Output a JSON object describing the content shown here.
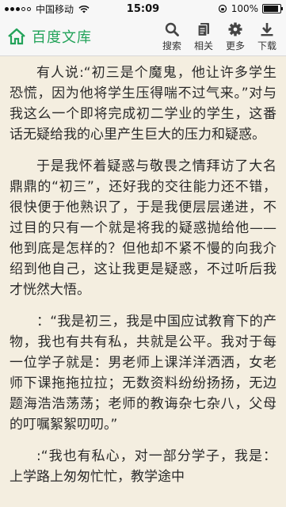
{
  "status_bar": {
    "carrier": "中国移动",
    "time": "15:09",
    "battery_text": "100%",
    "battery_level": 1.0
  },
  "app_bar": {
    "title": "百度文库",
    "tools": [
      {
        "label": "搜索",
        "icon": "search-icon"
      },
      {
        "label": "相关",
        "icon": "related-docs-icon"
      },
      {
        "label": "更多",
        "icon": "gear-icon"
      },
      {
        "label": "下载",
        "icon": "download-icon"
      }
    ]
  },
  "colors": {
    "brand": "#23a35a",
    "background": "#f4eee0",
    "text": "#2a2a2a",
    "icon": "#444444"
  },
  "article": {
    "paragraphs": [
      "有人说:“初三是个魔鬼，他让许多学生恐慌，因为他将学生压得喘不过气来。”对与我这么一个即将完成初二学业的学生，这番话无疑给我的心里产生巨大的压力和疑惑。",
      "于是我怀着疑惑与敬畏之情拜访了大名鼎鼎的“初三”，还好我的交往能力还不错，很快便于他熟识了，于是我便层层递进，不过目的只有一个就是将我的疑惑抛给他——他到底是怎样的？但他却不紧不慢的向我介绍到他自己，这让我更是疑惑，不过听后我才恍然大悟。",
      "：“我是初三，我是中国应试教育下的产物，我也有共有私，共就是公平。我对于每一位学子就是：男老师上课洋洋洒洒，女老师下课拖拖拉拉；无数资料纷纷扬扬，无边题海浩浩荡荡；老师的教诲杂七杂八，父母的叮嘱絮絮叨叨。”",
      ":“我也有私心，对一部分学子，我是：上学路上匆匆忙忙，教学途中"
    ]
  }
}
